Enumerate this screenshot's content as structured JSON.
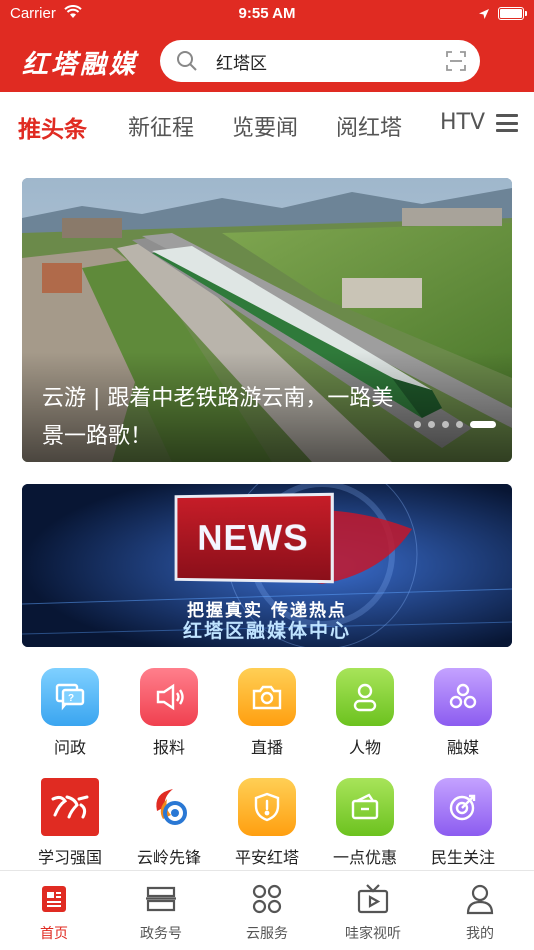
{
  "status_bar": {
    "carrier": "Carrier",
    "time": "9:55 AM"
  },
  "header": {
    "logo_text": "红塔融媒",
    "search": {
      "value": "红塔区"
    }
  },
  "tabs": [
    {
      "label": "推头条",
      "active": true
    },
    {
      "label": "新征程",
      "active": false
    },
    {
      "label": "览要闻",
      "active": false
    },
    {
      "label": "阅红塔",
      "active": false
    },
    {
      "label": "HTV",
      "active": false
    }
  ],
  "banner": {
    "caption": "云游 | 跟着中老铁路游云南，一路美景一路歌！",
    "slide_count": 5,
    "active_slide": 5
  },
  "news_banner": {
    "badge": "NEWS",
    "slogan": "把握真实  传递热点",
    "center_name": "红塔区融媒体中心"
  },
  "services": [
    {
      "label": "问政",
      "icon": "chat-icon",
      "color": "#5ab8f5"
    },
    {
      "label": "报料",
      "icon": "megaphone-icon",
      "color": "#f5586a"
    },
    {
      "label": "直播",
      "icon": "camera-icon",
      "color": "#ffb52b"
    },
    {
      "label": "人物",
      "icon": "person-icon",
      "color": "#8bd63a"
    },
    {
      "label": "融媒",
      "icon": "circles-icon",
      "color": "#a77cf2"
    },
    {
      "label": "学习强国",
      "icon": "xuexi-logo-icon",
      "color": "#e02b22"
    },
    {
      "label": "云岭先锋",
      "icon": "yunling-logo-icon",
      "color": "#ffffff"
    },
    {
      "label": "平安红塔",
      "icon": "shield-icon",
      "color": "#ffb52b"
    },
    {
      "label": "一点优惠",
      "icon": "wallet-icon",
      "color": "#8bd63a"
    },
    {
      "label": "民生关注",
      "icon": "target-icon",
      "color": "#a77cf2"
    }
  ],
  "bottom_nav": [
    {
      "label": "首页",
      "icon": "home-doc-icon",
      "active": true
    },
    {
      "label": "政务号",
      "icon": "stack-icon",
      "active": false
    },
    {
      "label": "云服务",
      "icon": "grid-icon",
      "active": false
    },
    {
      "label": "哇家视听",
      "icon": "tv-icon",
      "active": false
    },
    {
      "label": "我的",
      "icon": "user-icon",
      "active": false
    }
  ],
  "colors": {
    "brand": "#e02b22",
    "nav_inactive": "#555555"
  }
}
